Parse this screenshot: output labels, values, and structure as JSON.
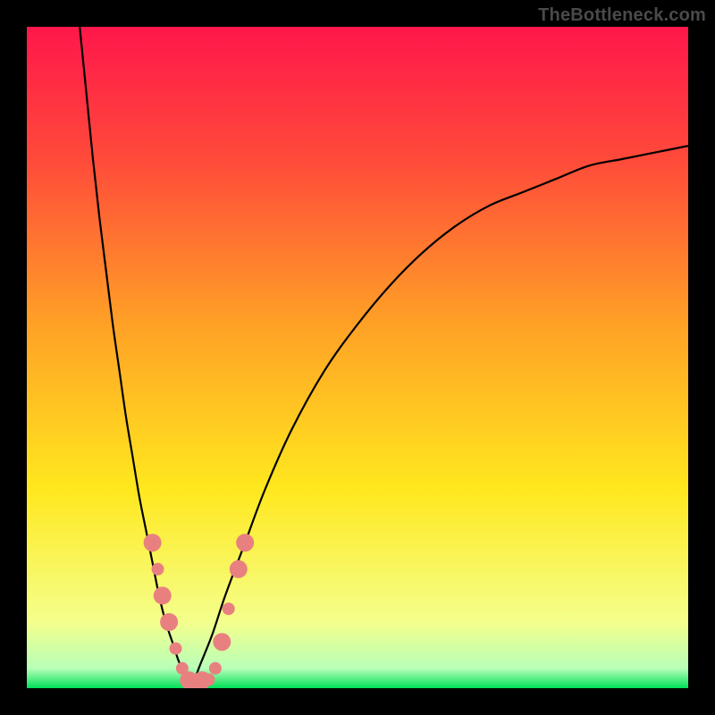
{
  "watermark": "TheBottleneck.com",
  "chart_data": {
    "type": "line",
    "title": "",
    "xlabel": "",
    "ylabel": "",
    "xlim": [
      0,
      100
    ],
    "ylim": [
      0,
      100
    ],
    "gradient_stops": [
      {
        "offset": 0,
        "color": "#ff174b"
      },
      {
        "offset": 20,
        "color": "#ff4a3a"
      },
      {
        "offset": 45,
        "color": "#ffa126"
      },
      {
        "offset": 70,
        "color": "#ffe81e"
      },
      {
        "offset": 90,
        "color": "#f4ff8c"
      },
      {
        "offset": 97,
        "color": "#b8ffb8"
      },
      {
        "offset": 100,
        "color": "#00e05a"
      }
    ],
    "series": [
      {
        "name": "left-branch",
        "x": [
          8,
          9,
          10,
          11,
          12,
          13,
          14,
          15,
          16,
          17,
          18,
          19,
          20,
          21,
          22,
          23,
          24,
          25
        ],
        "y": [
          100,
          90,
          80,
          71,
          63,
          55,
          48,
          41,
          35,
          29,
          24,
          19,
          14,
          10,
          7,
          4,
          2,
          0
        ]
      },
      {
        "name": "right-branch",
        "x": [
          25,
          26,
          28,
          30,
          33,
          36,
          40,
          45,
          50,
          55,
          60,
          65,
          70,
          75,
          80,
          85,
          90,
          95,
          100
        ],
        "y": [
          0,
          3,
          8,
          14,
          22,
          30,
          39,
          48,
          55,
          61,
          66,
          70,
          73,
          75,
          77,
          79,
          80,
          81,
          82
        ]
      }
    ],
    "points": {
      "name": "highlight-dots",
      "color": "#e98080",
      "radius_major": 10,
      "radius_minor": 7,
      "coords": [
        {
          "x": 19.0,
          "y": 22,
          "r": "major"
        },
        {
          "x": 19.8,
          "y": 18,
          "r": "minor"
        },
        {
          "x": 20.5,
          "y": 14,
          "r": "major"
        },
        {
          "x": 21.5,
          "y": 10,
          "r": "major"
        },
        {
          "x": 22.5,
          "y": 6,
          "r": "minor"
        },
        {
          "x": 23.5,
          "y": 3,
          "r": "minor"
        },
        {
          "x": 24.5,
          "y": 1.2,
          "r": "major"
        },
        {
          "x": 25.5,
          "y": 0.8,
          "r": "major"
        },
        {
          "x": 26.5,
          "y": 1.2,
          "r": "major"
        },
        {
          "x": 27.5,
          "y": 1.3,
          "r": "minor"
        },
        {
          "x": 28.5,
          "y": 3,
          "r": "minor"
        },
        {
          "x": 29.5,
          "y": 7,
          "r": "major"
        },
        {
          "x": 30.5,
          "y": 12,
          "r": "minor"
        },
        {
          "x": 32.0,
          "y": 18,
          "r": "major"
        },
        {
          "x": 33.0,
          "y": 22,
          "r": "major"
        }
      ]
    }
  }
}
